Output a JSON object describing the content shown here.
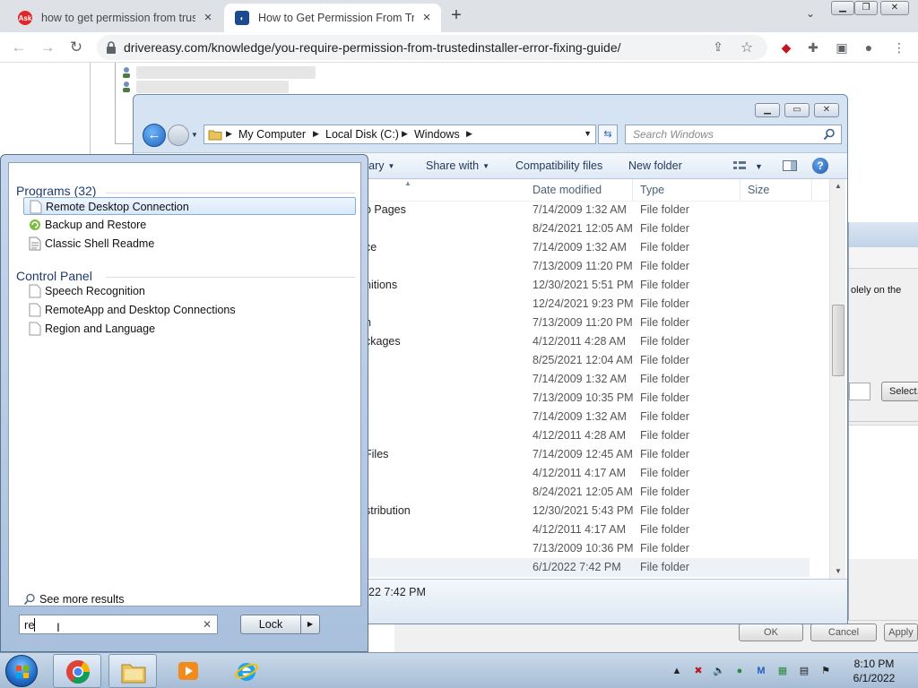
{
  "browser": {
    "tabs": [
      {
        "title": "how to get permission from trust",
        "active": false
      },
      {
        "title": "How to Get Permission From Trus",
        "active": true
      }
    ],
    "url": "drivereasy.com/knowledge/you-require-permission-from-trustedinstaller-error-fixing-guide/"
  },
  "explorer": {
    "address": [
      "My Computer",
      "Local Disk (C:)",
      "Windows"
    ],
    "search_placeholder": "Search Windows",
    "commands": [
      "rary",
      "Share with",
      "Compatibility files",
      "New folder"
    ],
    "columns": [
      "Date modified",
      "Type",
      "Size"
    ],
    "rows": [
      {
        "name": "o Pages",
        "date": "7/14/2009 1:32 AM",
        "type": "File folder"
      },
      {
        "name": "",
        "date": "8/24/2021 12:05 AM",
        "type": "File folder"
      },
      {
        "name": "ce",
        "date": "7/14/2009 1:32 AM",
        "type": "File folder"
      },
      {
        "name": "",
        "date": "7/13/2009 11:20 PM",
        "type": "File folder"
      },
      {
        "name": "nitions",
        "date": "12/30/2021 5:51 PM",
        "type": "File folder"
      },
      {
        "name": "",
        "date": "12/24/2021 9:23 PM",
        "type": "File folder"
      },
      {
        "name": "n",
        "date": "7/13/2009 11:20 PM",
        "type": "File folder"
      },
      {
        "name": "ckages",
        "date": "4/12/2011 4:28 AM",
        "type": "File folder"
      },
      {
        "name": "",
        "date": "8/25/2021 12:04 AM",
        "type": "File folder"
      },
      {
        "name": "",
        "date": "7/14/2009 1:32 AM",
        "type": "File folder"
      },
      {
        "name": "",
        "date": "7/13/2009 10:35 PM",
        "type": "File folder"
      },
      {
        "name": "",
        "date": "7/14/2009 1:32 AM",
        "type": "File folder"
      },
      {
        "name": "",
        "date": "4/12/2011 4:28 AM",
        "type": "File folder"
      },
      {
        "name": "Files",
        "date": "7/14/2009 12:45 AM",
        "type": "File folder"
      },
      {
        "name": "",
        "date": "4/12/2011 4:17 AM",
        "type": "File folder"
      },
      {
        "name": "",
        "date": "8/24/2021 12:05 AM",
        "type": "File folder"
      },
      {
        "name": "stribution",
        "date": "12/30/2021 5:43 PM",
        "type": "File folder"
      },
      {
        "name": "",
        "date": "4/12/2011 4:17 AM",
        "type": "File folder"
      },
      {
        "name": "",
        "date": "7/13/2009 10:36 PM",
        "type": "File folder"
      },
      {
        "name": "",
        "date": "6/1/2022 7:42 PM",
        "type": "File folder"
      }
    ],
    "details_text": "22 7:42 PM"
  },
  "dialog": {
    "text": "olely on the",
    "select_button": "Select...",
    "ok": "OK",
    "cancel": "Cancel",
    "apply": "Apply"
  },
  "start_menu": {
    "programs_header": "Programs (32)",
    "programs": [
      "Remote Desktop Connection",
      "Backup and Restore",
      "Classic Shell Readme"
    ],
    "control_panel_header": "Control Panel",
    "control_panel": [
      "Speech Recognition",
      "RemoteApp and Desktop Connections",
      "Region and Language"
    ],
    "see_more": "See more results",
    "search_value": "re",
    "lock_label": "Lock"
  },
  "taskbar": {
    "time": "8:10 PM",
    "date": "6/1/2022"
  }
}
